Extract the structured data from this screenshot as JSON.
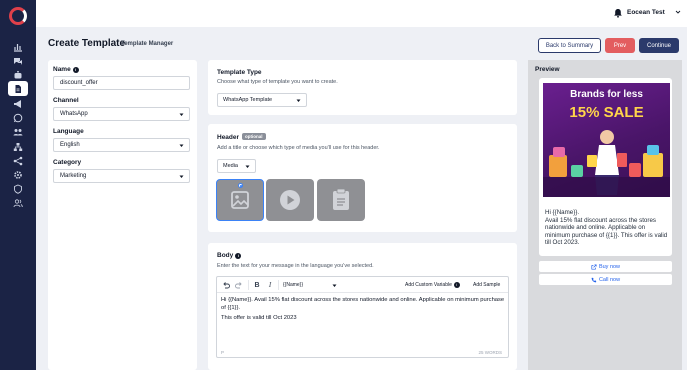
{
  "app": {
    "user_name": "Eocean Test"
  },
  "header": {
    "title": "Create Template",
    "breadcrumb": "Template Manager",
    "back_label": "Back to Summary",
    "previous_label": "Prev",
    "continue_label": "Continue"
  },
  "form": {
    "name_label": "Name",
    "name_value": "discount_offer",
    "channel_label": "Channel",
    "channel_value": "WhatsApp",
    "language_label": "Language",
    "language_value": "English",
    "category_label": "Category",
    "category_value": "Marketing"
  },
  "template_type": {
    "title": "Template Type",
    "description": "Choose what type of template you want to create.",
    "selected": "WhatsApp Template"
  },
  "header_section": {
    "title": "Header",
    "badge": "optional",
    "description": "Add a title or choose which type of media you'll use for this header.",
    "media_select": "Media",
    "media_tiles": [
      "image-icon",
      "video-icon",
      "document-icon"
    ]
  },
  "body_section": {
    "title": "Body",
    "description": "Enter the text for your message in the language you've selected.",
    "variable_select": "{{Name}}",
    "add_variable_label": "Add Custom Variable",
    "add_sample_label": "Add Sample",
    "text_line_1": "Hi {{Name}}. Avail 15% flat discount across the stores nationwide and online. Applicable on minimum purchase of {{1}}.",
    "text_line_2": "This offer is valid till Oct 2023",
    "footer_tag": "P",
    "word_count": "25 WORDS"
  },
  "preview": {
    "title": "Preview",
    "promo_brand": "Brands for less",
    "promo_sale": "15% SALE",
    "message": "Hi {{Name}}.\nAvail 15% flat discount across the stores nationwide and online. Applicable on minimum purchase of {{1}}. This offer is valid till Oct 2023.",
    "cta_buy": "Buy now",
    "cta_call": "Call now"
  },
  "colors": {
    "sidebar": "#1b2345",
    "primary": "#2b3a6b",
    "danger": "#e35d5f",
    "link": "#2563eb"
  }
}
